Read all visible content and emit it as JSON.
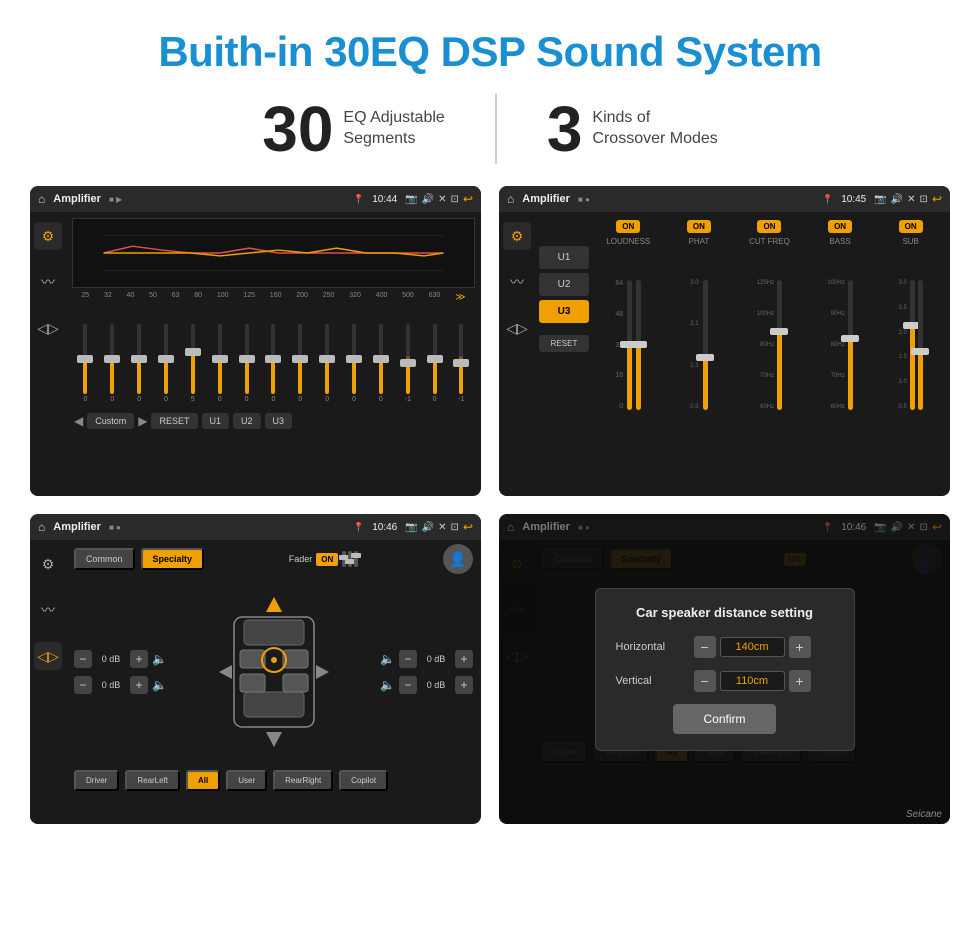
{
  "header": {
    "title": "Buith-in 30EQ DSP Sound System"
  },
  "stats": {
    "eq_number": "30",
    "eq_desc_line1": "EQ Adjustable",
    "eq_desc_line2": "Segments",
    "crossover_number": "3",
    "crossover_desc_line1": "Kinds of",
    "crossover_desc_line2": "Crossover Modes"
  },
  "screen1": {
    "topbar_title": "Amplifier",
    "topbar_time": "10:44",
    "eq_frequencies": [
      "25",
      "32",
      "40",
      "50",
      "63",
      "80",
      "100",
      "125",
      "160",
      "200",
      "250",
      "320",
      "400",
      "500",
      "630"
    ],
    "eq_values": [
      "0",
      "0",
      "0",
      "0",
      "5",
      "0",
      "0",
      "0",
      "0",
      "0",
      "0",
      "0",
      "-1",
      "0",
      "-1"
    ],
    "bottom_btns": {
      "custom": "Custom",
      "reset": "RESET",
      "u1": "U1",
      "u2": "U2",
      "u3": "U3"
    },
    "slider_positions": [
      50,
      50,
      50,
      50,
      60,
      50,
      50,
      50,
      50,
      50,
      50,
      50,
      43,
      50,
      43
    ]
  },
  "screen2": {
    "topbar_title": "Amplifier",
    "topbar_time": "10:45",
    "presets": [
      "U1",
      "U2",
      "U3"
    ],
    "active_preset": "U3",
    "bands": [
      {
        "toggle": "ON",
        "label": "LOUDNESS"
      },
      {
        "toggle": "ON",
        "label": "PHAT"
      },
      {
        "toggle": "ON",
        "label": "CUT FREQ"
      },
      {
        "toggle": "ON",
        "label": "BASS"
      },
      {
        "toggle": "ON",
        "label": "SUB"
      }
    ],
    "reset_label": "RESET"
  },
  "screen3": {
    "topbar_title": "Amplifier",
    "topbar_time": "10:46",
    "common_label": "Common",
    "specialty_label": "Specialty",
    "fader_label": "Fader",
    "fader_on": "ON",
    "controls": {
      "top_left_db": "0 dB",
      "bottom_left_db": "0 dB",
      "top_right_db": "0 dB",
      "bottom_right_db": "0 dB"
    },
    "bottom_btns": [
      "Driver",
      "RearLeft",
      "All",
      "User",
      "RearRight",
      "Copilot"
    ],
    "active_btn": "All"
  },
  "screen4": {
    "topbar_title": "Amplifier",
    "topbar_time": "10:46",
    "dialog": {
      "title": "Car speaker distance setting",
      "horizontal_label": "Horizontal",
      "horizontal_value": "140cm",
      "vertical_label": "Vertical",
      "vertical_value": "110cm",
      "confirm_label": "Confirm"
    },
    "common_label": "Common",
    "specialty_label": "Specialty",
    "bottom_btns": [
      "Driver",
      "RearLeft",
      "All",
      "User",
      "RearRight",
      "Copilot"
    ]
  },
  "watermark": "Seicane"
}
